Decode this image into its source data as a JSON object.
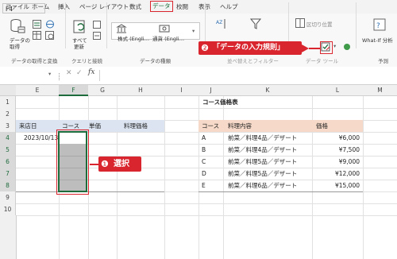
{
  "menu": {
    "items": [
      "ファイル",
      "ホーム",
      "挿入",
      "ページ レイアウト",
      "数式",
      "データ",
      "校閲",
      "表示",
      "ヘルプ"
    ],
    "active_index": 5
  },
  "ribbon": {
    "get_data_label_1": "データの",
    "get_data_label_2": "取得",
    "group_get_transform": "データの取得と変換",
    "refresh_label_1": "すべて",
    "refresh_label_2": "更新",
    "group_queries": "クエリと接続",
    "stocks_label": "株式 (Engli…",
    "currency_label": "通貨 (Engli…",
    "group_data_types": "データの種類",
    "sort_filter_partial": "並べ替えとフィルター",
    "group_data_tools_partial": "データ ツール",
    "whatif_label": "What-If 分析",
    "forecast_partial": "予測",
    "flash_fill_partial": "区切り位置"
  },
  "callouts": {
    "step2_number": "❷",
    "step2_text": "「データの入力規則」",
    "step1_number": "❶",
    "step1_text": "選択"
  },
  "formula_bar": {
    "name_box": "F4",
    "fx": "fx"
  },
  "columns": [
    "E",
    "F",
    "G",
    "H",
    "I",
    "J",
    "K",
    "L",
    "M"
  ],
  "rows": [
    "1",
    "2",
    "3",
    "4",
    "5",
    "6",
    "7",
    "8",
    "9",
    "10"
  ],
  "left_table": {
    "headers": [
      "来店日",
      "コース",
      "単価",
      "料理価格"
    ],
    "date_value": "2023/10/13"
  },
  "right_table": {
    "title": "コース価格表",
    "headers": [
      "コース",
      "料理内容",
      "価格"
    ],
    "rows": [
      {
        "course": "A",
        "content": "前菜／料理4品／デザート",
        "price": "¥6,000"
      },
      {
        "course": "B",
        "content": "前菜／料理4品／デザート",
        "price": "¥7,500"
      },
      {
        "course": "C",
        "content": "前菜／料理5品／デザート",
        "price": "¥9,000"
      },
      {
        "course": "D",
        "content": "前菜／料理5品／デザート",
        "price": "¥12,000"
      },
      {
        "course": "E",
        "content": "前菜／料理6品／デザート",
        "price": "¥15,000"
      }
    ]
  },
  "colors": {
    "accent_red": "#d9262e",
    "excel_green": "#1e6b3c",
    "header_blue": "#dbe4f0",
    "header_peach": "#f6d9c8"
  }
}
